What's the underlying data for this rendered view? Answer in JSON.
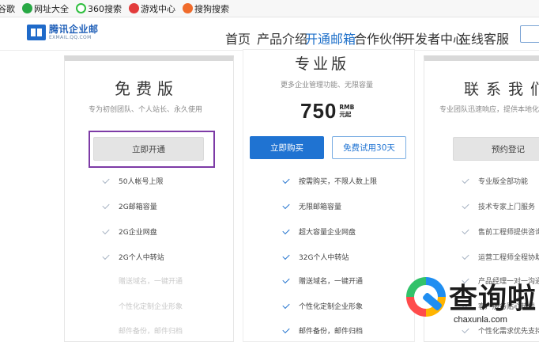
{
  "bookmarks": [
    {
      "label": "谷歌",
      "icon": "google-icon",
      "color": "#ffffff"
    },
    {
      "label": "网址大全",
      "icon": "site-nav-icon",
      "color": "#27a844"
    },
    {
      "label": "360搜索",
      "icon": "360-search-icon",
      "color": "#2fbf3f"
    },
    {
      "label": "游戏中心",
      "icon": "game-center-icon",
      "color": "#e23b3b"
    },
    {
      "label": "搜狗搜索",
      "icon": "sogou-icon",
      "color": "#f06b2b"
    }
  ],
  "logo": {
    "cn": "腾讯企业邮",
    "en": "EXMAIL.QQ.COM"
  },
  "nav": [
    "首页",
    "产品介绍",
    "开通邮箱",
    "合作伙伴",
    "开发者中心",
    "在线客服"
  ],
  "nav_active": "开通邮箱",
  "plans": {
    "free": {
      "title": "免费版",
      "subtitle": "专为初创团队、个人站长、永久使用",
      "button": "立即开通",
      "features": [
        "50人帐号上限",
        "2G邮箱容量",
        "2G企业网盘",
        "2G个人中转站"
      ],
      "muted_features": [
        "赠送域名，一键开通",
        "个性化定制企业形象",
        "邮件备份，邮件归档"
      ]
    },
    "pro": {
      "title": "专业版",
      "subtitle": "更多企业管理功能、无限容量",
      "price": "750",
      "price_currency": "RMB",
      "price_suffix": "元起",
      "buy_button": "立即购买",
      "trial_button": "免费试用30天",
      "features": [
        "按需购买，不限人数上限",
        "无限邮箱容量",
        "超大容量企业网盘",
        "32G个人中转站",
        "赠送域名，一键开通",
        "个性化定制企业形象",
        "邮件备份，邮件归档"
      ]
    },
    "contact": {
      "title": "联系我们",
      "subtitle": "专业团队迅速响应，提供本地化",
      "button": "预约登记",
      "features": [
        "专业版全部功能",
        "技术专家上门服务",
        "售前工程师提供咨询",
        "运营工程师全程协助",
        "产品经理一对一沟通",
        "客户服务贴心热线",
        "个性化需求优先支持"
      ]
    }
  },
  "watermark": {
    "cn": "查询啦",
    "en": "chaxunla.com"
  },
  "colors": {
    "brand_blue": "#1f73d2",
    "highlight_purple": "#7d3ba6"
  }
}
